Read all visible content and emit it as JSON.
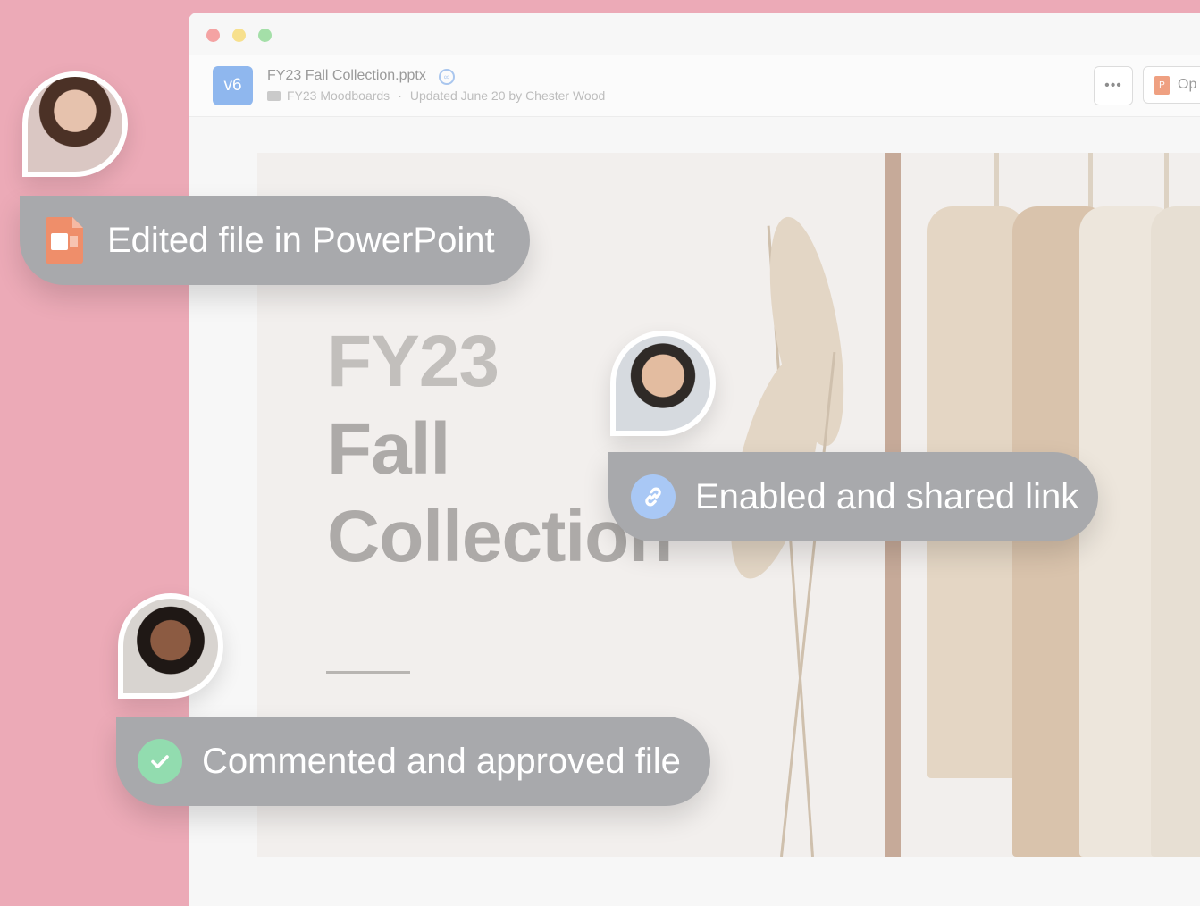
{
  "window": {
    "controls": [
      "close",
      "minimize",
      "maximize"
    ]
  },
  "file": {
    "version": "v6",
    "name": "FY23 Fall Collection.pptx",
    "folder": "FY23 Moodboards",
    "separator": "·",
    "updated": "Updated June 20 by Chester Wood"
  },
  "header": {
    "more_label": "•••",
    "open_label": "Op",
    "open_icon": "powerpoint-icon"
  },
  "slide": {
    "title_line1": "FY23",
    "title_line2": "Fall",
    "title_line3": "Collection"
  },
  "activity": [
    {
      "label": "Edited file in PowerPoint",
      "icon": "powerpoint-icon",
      "icon_text": "P"
    },
    {
      "label": "Enabled and shared link",
      "icon": "link-icon",
      "icon_color": "#a9c8f5"
    },
    {
      "label": "Commented and approved file",
      "icon": "check-icon",
      "icon_color": "#92dcaf"
    }
  ],
  "colors": {
    "background": "#ecaab7",
    "pill": "#a8a9ac",
    "version_badge": "#8fb7ee",
    "powerpoint": "#ef8e6a"
  }
}
